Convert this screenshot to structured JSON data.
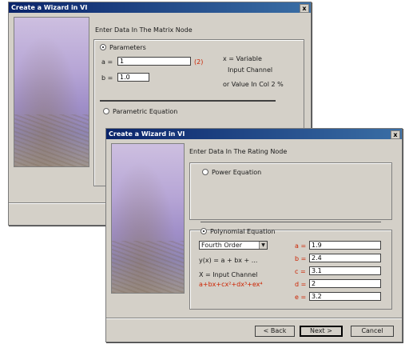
{
  "back_window": {
    "title": "Create a Wizard in VI",
    "close_label": "x",
    "heading": "Enter Data In The Matrix Node",
    "group_label": "Parameters",
    "field1_label": "a =",
    "field1_value": "1",
    "field1_unit": "(2)",
    "field2_label": "b =",
    "field2_value": "1.0",
    "right_text_1": "x = Variable",
    "right_text_2": "Input Channel",
    "right_text_3": "or Value In Col 2 %",
    "radio_label": "Parametric Equation"
  },
  "front_window": {
    "title": "Create a Wizard in VI",
    "close_label": "x",
    "heading": "Enter Data In The Rating Node",
    "radio1_label": "Power Equation",
    "radio2_label": "Polynomial Equation",
    "dropdown_value": "Fourth Order",
    "help_text_1": "y(x) = a + bx + ...",
    "help_text_2": "X = Input Channel",
    "formula_text": "a+bx+cx²+dx³+ex⁴",
    "coefficients": [
      {
        "label": "a =",
        "value": "1.9"
      },
      {
        "label": "b =",
        "value": "2.4"
      },
      {
        "label": "c =",
        "value": "3.1"
      },
      {
        "label": "d =",
        "value": "2"
      },
      {
        "label": "e =",
        "value": "3.2"
      }
    ],
    "back_button": "< Back",
    "next_button": "Next >",
    "cancel_button": "Cancel"
  },
  "colors": {
    "titlebar_start": "#0a246a",
    "titlebar_end": "#3a6ea5",
    "dialog_bg": "#d4d0c8",
    "coef_label": "#cc2200"
  }
}
